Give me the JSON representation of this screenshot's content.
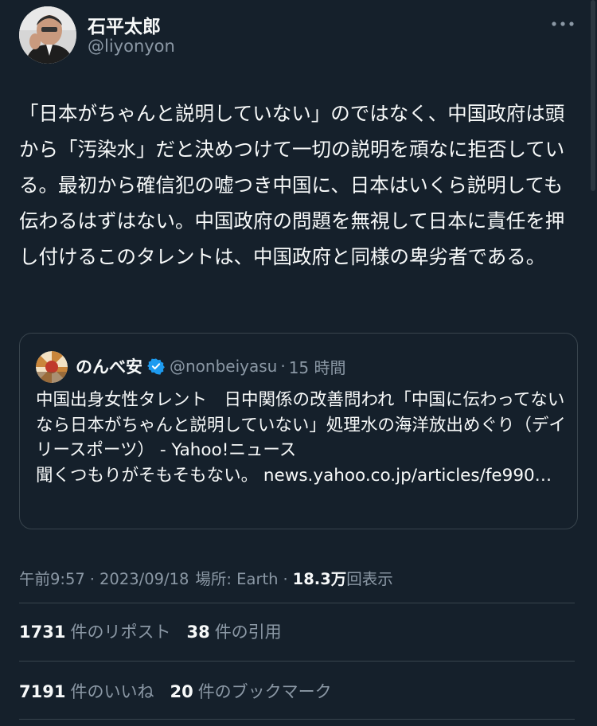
{
  "author": {
    "name": "石平太郎",
    "handle": "@liyonyon"
  },
  "tweet": {
    "text": "「日本がちゃんと説明していない」のではなく、中国政府は頭から「汚染水」だと決めつけて一切の説明を頑なに拒否している。最初から確信犯の嘘つき中国に、日本はいくら説明しても伝わるはずはない。中国政府の問題を無視して日本に責任を押し付けるこのタレントは、中国政府と同様の卑劣者である。"
  },
  "quote": {
    "name": "のんべ安",
    "handle": "@nonbeiyasu",
    "dot": "·",
    "time": "15 時間",
    "text": "中国出身女性タレント　日中関係の改善問われ「中国に伝わってないなら日本がちゃんと説明していない」処理水の海洋放出めぐり（デイリースポーツ） - Yahoo!ニュース\n聞くつもりがそもそもない。 news.yahoo.co.jp/articles/fe990…"
  },
  "meta": {
    "time": "午前9:57",
    "sep1": "·",
    "date": "2023/09/18",
    "location": "場所: Earth",
    "sep2": "·",
    "views_num": "18.3万",
    "views_label": "回表示"
  },
  "stats": {
    "reposts_num": "1731",
    "reposts_label": "件のリポスト",
    "quotes_num": "38",
    "quotes_label": "件の引用",
    "likes_num": "7191",
    "likes_label": "件のいいね",
    "bookmarks_num": "20",
    "bookmarks_label": "件のブックマーク"
  },
  "colors": {
    "background": "#15202b",
    "text_primary": "#f7f9f9",
    "text_secondary": "#8b98a5",
    "border": "#38444d",
    "verified": "#1d9bf0"
  },
  "icons": {
    "more": "more-horizontal-icon",
    "verified": "verified-badge-icon"
  }
}
